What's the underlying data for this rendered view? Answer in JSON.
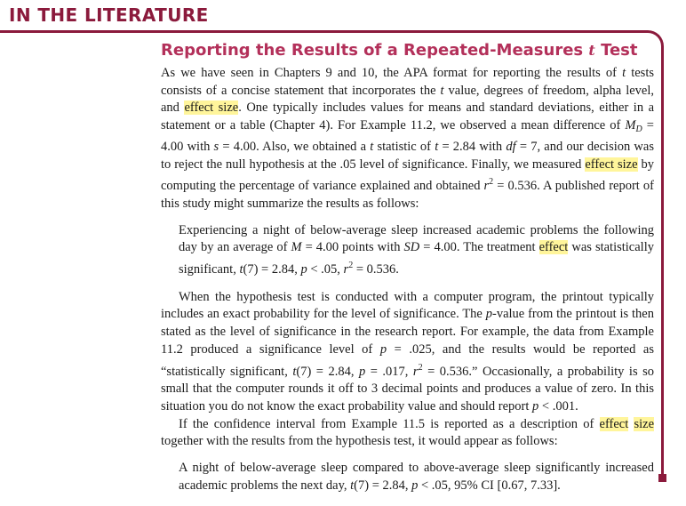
{
  "section_label": "IN THE LITERATURE",
  "box": {
    "title": "Reporting the Results of a Repeated-Measures ",
    "title_t": "t",
    "title_end": " Test"
  },
  "p1": {
    "s1": "As we have seen in Chapters 9 and 10, the APA format for reporting the results of ",
    "t1": "t",
    "s2": " tests consists of a concise statement that incorporates the ",
    "t2": "t",
    "s3": " value, degrees of freedom, alpha level, and ",
    "hl1": "effect size",
    "s4": ". One typically includes values for means and standard deviations, either in a statement or a table (Chapter 4). For Example 11.2, we observed a mean difference of ",
    "M": "M",
    "D": "D",
    "s5": " = 4.00 with ",
    "s_var": "s",
    "s6": " = 4.00. Also, we obtained a ",
    "t3": "t",
    "s7": " statistic of ",
    "t4": "t",
    "s8": " = 2.84 with ",
    "df": "df",
    "s9": " = 7, and our decision was to reject the null hypothesis at the .05 level of significance. Finally, we measured ",
    "hl2": "effect size",
    "s10": " by computing the percentage of variance explained and obtained ",
    "r": "r",
    "r_exp": "2",
    "s11": " = 0.536. A published report of this study might summarize the results as follows:"
  },
  "q1": {
    "s1": "Experiencing a night of below-average sleep increased academic problems the following day by an average of ",
    "M": "M",
    "s2": " = 4.00 points with ",
    "SD": "SD",
    "s3": " = 4.00. The treatment ",
    "hl": "effect",
    "s4": " was statistically significant, ",
    "t": "t",
    "s5": "(7) = 2.84, ",
    "p": "p",
    "s6": " < .05, ",
    "r": "r",
    "r_exp": "2",
    "s7": " = 0.536."
  },
  "p2": {
    "s1": "When the hypothesis test is conducted with a computer program, the printout typically includes an exact probability for the level of significance. The ",
    "p1": "p",
    "s2": "-value from the printout is then stated as the level of significance in the research report. For example, the data from Example 11.2 produced a significance level of ",
    "p2": "p",
    "s3": " = .025, and the results would be reported as “statistically significant, ",
    "t": "t",
    "s4": "(7) = 2.84, ",
    "p3": "p",
    "s5": " = .017, ",
    "r": "r",
    "r_exp": "2",
    "s6": " = 0.536.” Occasionally, a probability is so small that the computer rounds it off to 3 decimal points and produces a value of zero. In this situation you do not know the exact probability value and should report ",
    "p4": "p",
    "s7": " < .001."
  },
  "p3": {
    "s1": "If the confidence interval from Example 11.5 is reported as a description of ",
    "hl1": "effect",
    "s2": " ",
    "hl2": "size",
    "s3": " together with the results from the hypothesis test, it would appear as follows:"
  },
  "q2": {
    "s1": "A night of below-average sleep compared to above-average sleep significantly increased academic problems the next day, ",
    "t": "t",
    "s2": "(7) = 2.84, ",
    "p": "p",
    "s3": " < .05, 95% CI [0.67, 7.33]."
  },
  "colors": {
    "accent": "#8b1a3c",
    "title": "#b3305a",
    "highlight": "#fff59b"
  }
}
